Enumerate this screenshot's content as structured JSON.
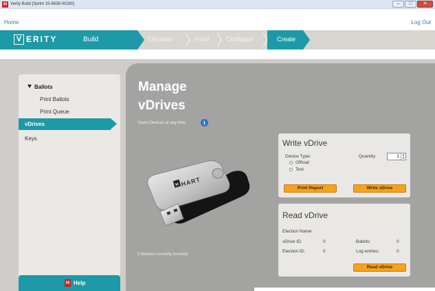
{
  "window": {
    "title": "Verity Build [Sprint 15-6638-00280]",
    "app_icon": "hart-logo-icon",
    "controls": {
      "minimize": "–",
      "maximize": "□",
      "close": "✕"
    }
  },
  "nav": {
    "home": "Home",
    "logout": "Log Out"
  },
  "header": {
    "logo_v": "V",
    "logo_rest": "ERITY",
    "product": "Build",
    "steps": [
      "Elections",
      "Proof",
      "Configure",
      "Create"
    ],
    "active_step": "Create",
    "accent_color": "#1d99a7"
  },
  "sidebar": {
    "group": "Ballots",
    "sub_items": [
      "Print Ballots",
      "Print Queue"
    ],
    "items": [
      "vDrives",
      "Keys"
    ],
    "active_item": "vDrives",
    "help_label": "Help"
  },
  "main": {
    "title_line1": "Manage",
    "title_line2": "vDrives",
    "insert_hint": "Insert Devices at any time",
    "info_icon": "i",
    "devices_status": "0 devices currently inserted",
    "usb_brand": "HART"
  },
  "write_card": {
    "title": "Write vDrive",
    "device_type_label": "Device Type:",
    "options": [
      "Official",
      "Test"
    ],
    "quantity_label": "Quantity",
    "quantity_value": "1",
    "print_report_btn": "Print Report",
    "write_btn": "Write vDrive",
    "button_color": "#f5a21d"
  },
  "read_card": {
    "title": "Read vDrive",
    "election_name_label": "Election Name:",
    "vdrive_id_label": "vDrive ID:",
    "vdrive_id_value": "0",
    "election_id_label": "Election ID:",
    "election_id_value": "0",
    "ballots_label": "Ballots:",
    "ballots_value": "0",
    "log_entries_label": "Log entries:",
    "log_entries_value": "0",
    "read_btn": "Read vDrive"
  }
}
